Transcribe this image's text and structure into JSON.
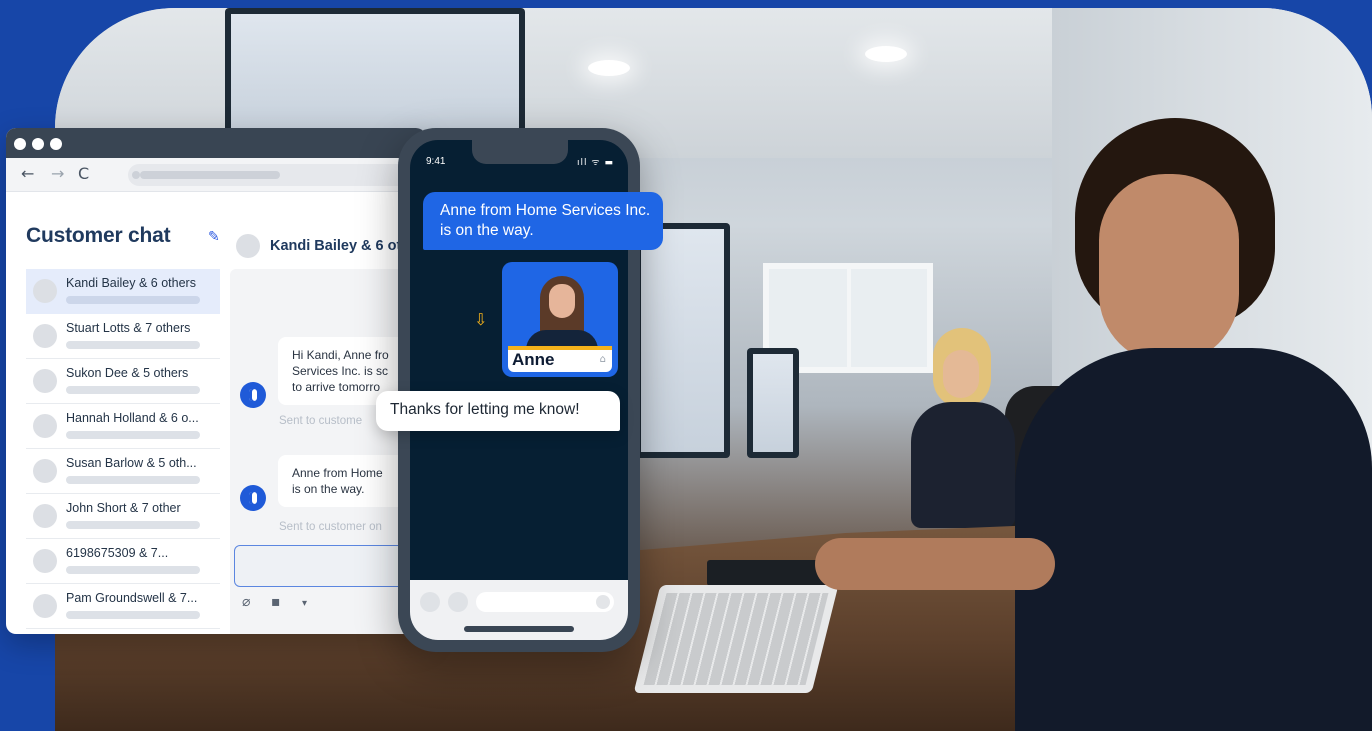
{
  "browser": {
    "nav": {
      "back_icon": "←",
      "forward_icon": "→",
      "reload_icon": "C"
    },
    "sidebar": {
      "title": "Customer chat",
      "compose_icon": "edit-icon",
      "conversations": [
        {
          "name": "Kandi Bailey & 6 others",
          "active": true
        },
        {
          "name": "Stuart Lotts & 7 others"
        },
        {
          "name": "Sukon Dee & 5 others"
        },
        {
          "name": "Hannah Holland & 6 o..."
        },
        {
          "name": "Susan Barlow & 5 oth..."
        },
        {
          "name": "John Short & 7 other"
        },
        {
          "name": "6198675309 & 7..."
        },
        {
          "name": "Pam Groundswell & 7..."
        }
      ]
    },
    "thread": {
      "header_name": "Kandi Bailey & 6 ot",
      "messages": [
        {
          "lines": [
            "Hi Kandi, Anne fro",
            "Services Inc. is sc",
            "to arrive tomorro"
          ],
          "note": "Sent to custome"
        },
        {
          "lines": [
            "Anne from Home",
            "is on the way."
          ],
          "note": "Sent to customer on"
        }
      ]
    }
  },
  "phone": {
    "time": "9:41",
    "status_icons": "ıll ᯤ ▬",
    "incoming_message": "Anne from Home Services Inc. is on the way.",
    "card_name": "Anne",
    "card_logo_icon": "home-services-logo-icon",
    "reply_message": "Thanks for letting me know!"
  },
  "colors": {
    "brand_blue": "#1746a8",
    "bubble_blue": "#1f66e5",
    "phone_dark": "#061f33",
    "accent_yellow": "#f5b21b"
  }
}
